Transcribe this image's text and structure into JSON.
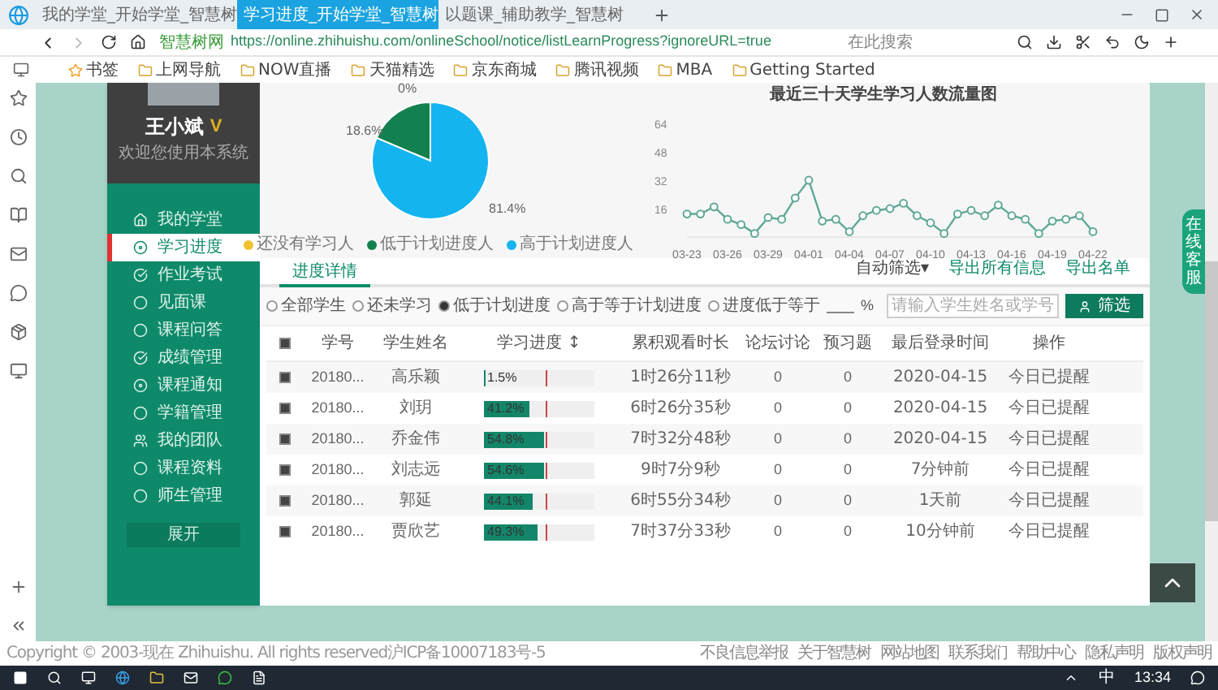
{
  "browser": {
    "tabs": [
      {
        "title": "我的学堂_开始学堂_智慧树",
        "selected": false
      },
      {
        "title": "学习进度_开始学堂_智慧树",
        "selected": true
      },
      {
        "title": "以题课_辅助教学_智慧树",
        "selected": false
      }
    ],
    "address": {
      "badge": "智慧树网",
      "url": "https://online.zhihuishu.com/onlineSchool/notice/listLearnProgress?ignoreURL=true"
    },
    "search_placeholder": "在此搜索",
    "bookmarks": [
      "书签",
      "上网导航",
      "NOW直播",
      "天猫精选",
      "京东商城",
      "腾讯视频",
      "MBA",
      "Getting Started"
    ]
  },
  "sidebar": {
    "user": "王小斌",
    "user_badge": "V",
    "subtitle": "欢迎您使用本系统",
    "items": [
      {
        "label": "我的学堂",
        "selected": false
      },
      {
        "label": "学习进度",
        "selected": true
      },
      {
        "label": "作业考试",
        "selected": false
      },
      {
        "label": "见面课",
        "selected": false
      },
      {
        "label": "课程问答",
        "selected": false
      },
      {
        "label": "成绩管理",
        "selected": false
      },
      {
        "label": "课程通知",
        "selected": false
      },
      {
        "label": "学籍管理",
        "selected": false
      },
      {
        "label": "我的团队",
        "selected": false
      },
      {
        "label": "课程资料",
        "selected": false
      },
      {
        "label": "师生管理",
        "selected": false
      }
    ],
    "expand": "展开"
  },
  "pie": {
    "chart_data": {
      "type": "pie",
      "categories": [
        "还没有学习人",
        "低于计划进度人",
        "高于计划进度人"
      ],
      "series": [
        {
          "values": [
            0,
            18.6,
            81.4
          ]
        }
      ],
      "colors": [
        "#f2c12e",
        "#12804f",
        "#14b4f0"
      ],
      "value_labels": [
        "0%",
        "18.6%",
        "81.4%"
      ]
    }
  },
  "line": {
    "chart_data": {
      "type": "line",
      "title": "最近三十天学生学习人数流量图",
      "categories": [
        "03-23",
        null,
        null,
        "03-26",
        null,
        null,
        "03-29",
        null,
        null,
        "04-01",
        null,
        null,
        "04-04",
        null,
        null,
        "04-07",
        null,
        null,
        "04-10",
        null,
        null,
        "04-13",
        null,
        null,
        "04-16",
        null,
        null,
        "04-19",
        null,
        null,
        "04-22"
      ],
      "series": [
        {
          "color": "#5fa896",
          "marker": "circle",
          "values": [
            13,
            13,
            17,
            10,
            7,
            2,
            11,
            10,
            22,
            32,
            9,
            10,
            3,
            12,
            15,
            16,
            19,
            12,
            8,
            2,
            13,
            15,
            12,
            18,
            12,
            10,
            2,
            9,
            10,
            12,
            3
          ]
        }
      ],
      "ylim": [
        0,
        64
      ],
      "yticks": [
        16,
        32,
        48,
        64
      ]
    }
  },
  "progress": {
    "tab": "进度详情",
    "tools": [
      "自动筛选▾",
      "导出所有信息",
      "导出名单"
    ],
    "filters": [
      {
        "label": "全部学生",
        "selected": false
      },
      {
        "label": "还未学习",
        "selected": false
      },
      {
        "label": "低于计划进度",
        "selected": true
      },
      {
        "label": "高于等于计划进度",
        "selected": false
      },
      {
        "label": "进度低于等于",
        "selected": false
      }
    ],
    "percent_sign": "%",
    "search_placeholder": "请输入学生姓名或学号",
    "button": "筛选"
  },
  "table": {
    "header_checked": true,
    "columns": [
      "学号",
      "学生姓名",
      "学习进度 ↕",
      "累积观看时长",
      "论坛讨论",
      "预习题",
      "最后登录时间",
      "操作"
    ],
    "rows": [
      {
        "checked": true,
        "id": "20180...",
        "name": "高乐颖",
        "level": 0.015,
        "reading": "1.5%",
        "time": "1时26分11秒",
        "forum": "0",
        "preview": "0",
        "last": "2020-04-15",
        "action": "今日已提醒"
      },
      {
        "checked": true,
        "id": "20180...",
        "name": "刘玥",
        "level": 0.41,
        "reading": "41.2%",
        "time": "6时26分35秒",
        "forum": "0",
        "preview": "0",
        "last": "2020-04-15",
        "action": "今日已提醒"
      },
      {
        "checked": true,
        "id": "20180...",
        "name": "乔金伟",
        "level": 0.55,
        "reading": "54.8%",
        "time": "7时32分48秒",
        "forum": "0",
        "preview": "0",
        "last": "2020-04-15",
        "action": "今日已提醒"
      },
      {
        "checked": true,
        "id": "20180...",
        "name": "刘志远",
        "level": 0.55,
        "reading": "54.6%",
        "time": "9时7分9秒",
        "forum": "0",
        "preview": "0",
        "last": "7分钟前",
        "action": "今日已提醒"
      },
      {
        "checked": true,
        "id": "20180...",
        "name": "郭延",
        "level": 0.44,
        "reading": "44.1%",
        "time": "6时55分34秒",
        "forum": "0",
        "preview": "0",
        "last": "1天前",
        "action": "今日已提醒"
      },
      {
        "checked": true,
        "id": "20180...",
        "name": "贾欣艺",
        "level": 0.49,
        "reading": "49.3%",
        "time": "7时37分33秒",
        "forum": "0",
        "preview": "0",
        "last": "10分钟前",
        "action": "今日已提醒"
      }
    ]
  },
  "online_service": "在线客服",
  "footer": {
    "copyright": "Copyright © 2003-现在 Zhihuishu. All rights reserved沪ICP备10007183号-5",
    "links": [
      "不良信息举报",
      "关于智慧树",
      "网站地图",
      "联系我们",
      "帮助中心",
      "隐私声明",
      "版权声明"
    ]
  },
  "taskbar": {
    "ime": "中",
    "time": "13:34"
  }
}
